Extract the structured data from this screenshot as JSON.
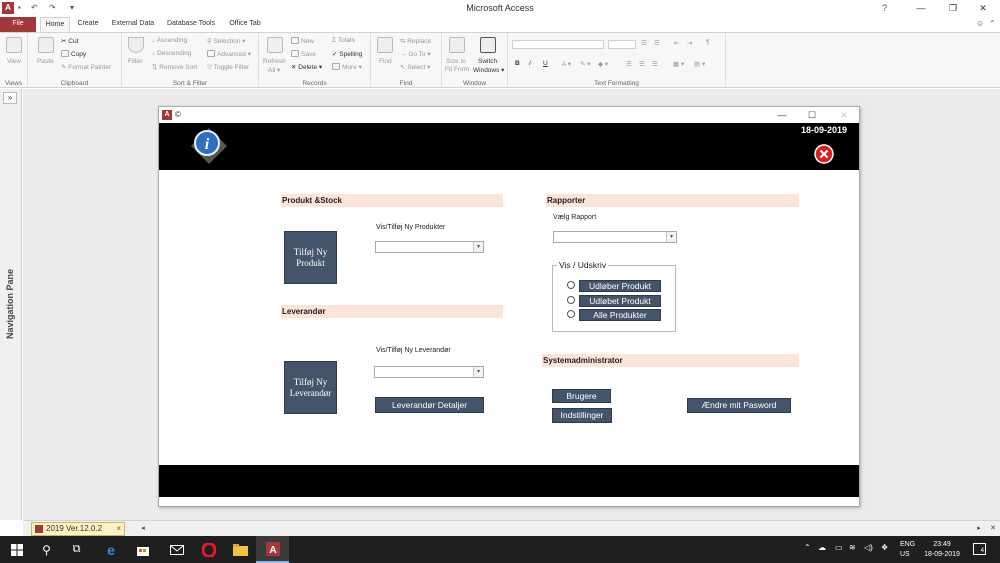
{
  "window": {
    "title": "Microsoft Access",
    "app_icon": "A",
    "qat_items": [
      "save-icon",
      "undo-icon",
      "redo-icon",
      "customize-icon"
    ],
    "controls": [
      "minimize-icon",
      "restore-icon",
      "close-icon"
    ]
  },
  "ribbon": {
    "tabs": [
      "File",
      "Home",
      "Create",
      "External Data",
      "Database Tools",
      "Office Tab"
    ],
    "active_tab": "Home",
    "groups": {
      "views": {
        "label": "Views",
        "view": "View"
      },
      "clipboard": {
        "label": "Clipboard",
        "paste": "Paste",
        "cut": "Cut",
        "copy": "Copy",
        "format_painter": "Format Painter"
      },
      "sort_filter": {
        "label": "Sort & Filter",
        "filter": "Filter",
        "ascending": "Ascending",
        "descending": "Descending",
        "remove_sort": "Remove Sort",
        "selection": "Selection",
        "advanced": "Advanced",
        "toggle_filter": "Toggle Filter"
      },
      "records": {
        "label": "Records",
        "refresh": "Refresh",
        "refresh_all": "All",
        "new": "New",
        "save": "Save",
        "delete": "Delete",
        "totals": "Totals",
        "spelling": "Spelling",
        "more": "More"
      },
      "find": {
        "label": "Find",
        "find": "Find",
        "replace": "Replace",
        "go_to": "Go To",
        "select": "Select"
      },
      "window": {
        "label": "Window",
        "size_to_fit": "Size to",
        "size_to_fit_2": "Fit Form",
        "switch": "Switch",
        "switch_2": "Windows"
      },
      "text_formatting": {
        "label": "Text Formatting"
      }
    }
  },
  "nav_pane": {
    "label": "Navigation Pane",
    "toggle": "»"
  },
  "form": {
    "title_symbol": "©",
    "date": "18-09-2019",
    "produkt": {
      "header": "Produkt &Stock",
      "dropdown_label": "Vis/Tilføj Ny Produkter",
      "tile_label": "Tilføj Ny Produkt"
    },
    "leverandor": {
      "header": "Leverandør",
      "dropdown_label": "Vis/Tilføj Ny Leverandør",
      "tile_label": "Tilføj Ny Leverandør",
      "details_button": "Leverandør Detaljer"
    },
    "rapporter": {
      "header": "Rapporter",
      "dropdown_label": "Vælg Rapport",
      "frame_label": "Vis  /  Udskriv",
      "options": [
        "Udløber Produkt",
        "Udløbet Produkt",
        "Alle Produkter"
      ]
    },
    "system": {
      "header": "Systemadministrator",
      "users_button": "Brugere",
      "settings_button": "Indstillinger",
      "password_button": "Ændre mit Pasword"
    }
  },
  "doc_tab": {
    "label": "2019 Ver.12.0.2",
    "close": "×"
  },
  "taskbar": {
    "lang_1": "ENG",
    "lang_2": "US",
    "time": "23:49",
    "date": "18-09-2019",
    "notifications": "4"
  },
  "colors": {
    "access_red": "#a4373a",
    "section_header": "#fce4d6",
    "button_slate": "#44546a",
    "header_black": "#000000"
  }
}
